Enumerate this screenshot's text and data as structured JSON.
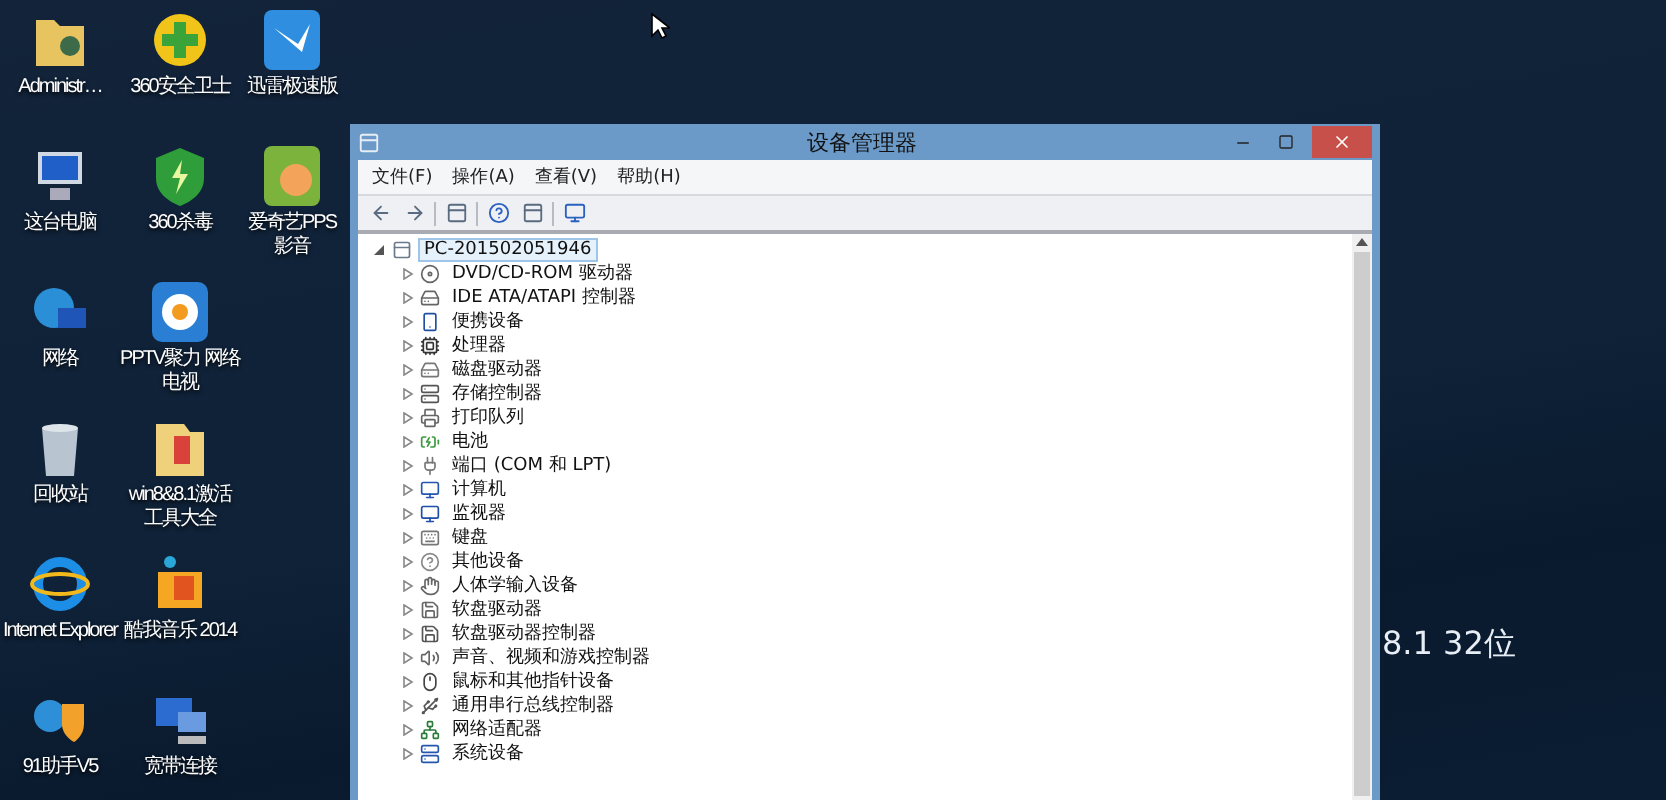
{
  "desktop_icons": [
    {
      "label": "Administr…"
    },
    {
      "label": "360安全卫士"
    },
    {
      "label": "迅雷极速版"
    },
    {
      "label": "这台电脑"
    },
    {
      "label": "360杀毒"
    },
    {
      "label": "爱奇艺PPS影音"
    },
    {
      "label": "网络"
    },
    {
      "label": "PPTV聚力 网络电视"
    },
    {
      "label": "回收站"
    },
    {
      "label": "win8&8.1激活工具大全"
    },
    {
      "label": "Internet Explorer"
    },
    {
      "label": "酷我音乐 2014"
    },
    {
      "label": "91助手V5"
    },
    {
      "label": "宽带连接"
    }
  ],
  "wallpaper_text": "8.1 32位",
  "window": {
    "title": "设备管理器",
    "menu": [
      "文件(F)",
      "操作(A)",
      "查看(V)",
      "帮助(H)"
    ]
  },
  "tree": {
    "label": "PC-201502051946",
    "expanded": true,
    "selected": true,
    "children": [
      {
        "label": "DVD/CD-ROM 驱动器",
        "expanded": false,
        "selected": false
      },
      {
        "label": "IDE ATA/ATAPI 控制器",
        "expanded": false,
        "selected": false
      },
      {
        "label": "便携设备",
        "expanded": false,
        "selected": false
      },
      {
        "label": "处理器",
        "expanded": false,
        "selected": false
      },
      {
        "label": "磁盘驱动器",
        "expanded": false,
        "selected": false
      },
      {
        "label": "存储控制器",
        "expanded": false,
        "selected": false
      },
      {
        "label": "打印队列",
        "expanded": false,
        "selected": false
      },
      {
        "label": "电池",
        "expanded": false,
        "selected": false
      },
      {
        "label": "端口 (COM 和 LPT)",
        "expanded": false,
        "selected": false
      },
      {
        "label": "计算机",
        "expanded": false,
        "selected": false
      },
      {
        "label": "监视器",
        "expanded": false,
        "selected": false
      },
      {
        "label": "键盘",
        "expanded": false,
        "selected": false
      },
      {
        "label": "其他设备",
        "expanded": false,
        "selected": false
      },
      {
        "label": "人体学输入设备",
        "expanded": false,
        "selected": false
      },
      {
        "label": "软盘驱动器",
        "expanded": false,
        "selected": false
      },
      {
        "label": "软盘驱动器控制器",
        "expanded": false,
        "selected": false
      },
      {
        "label": "声音、视频和游戏控制器",
        "expanded": false,
        "selected": false
      },
      {
        "label": "鼠标和其他指针设备",
        "expanded": false,
        "selected": false
      },
      {
        "label": "通用串行总线控制器",
        "expanded": false,
        "selected": false
      },
      {
        "label": "网络适配器",
        "expanded": false,
        "selected": false
      },
      {
        "label": "系统设备",
        "expanded": false,
        "selected": false
      }
    ]
  }
}
